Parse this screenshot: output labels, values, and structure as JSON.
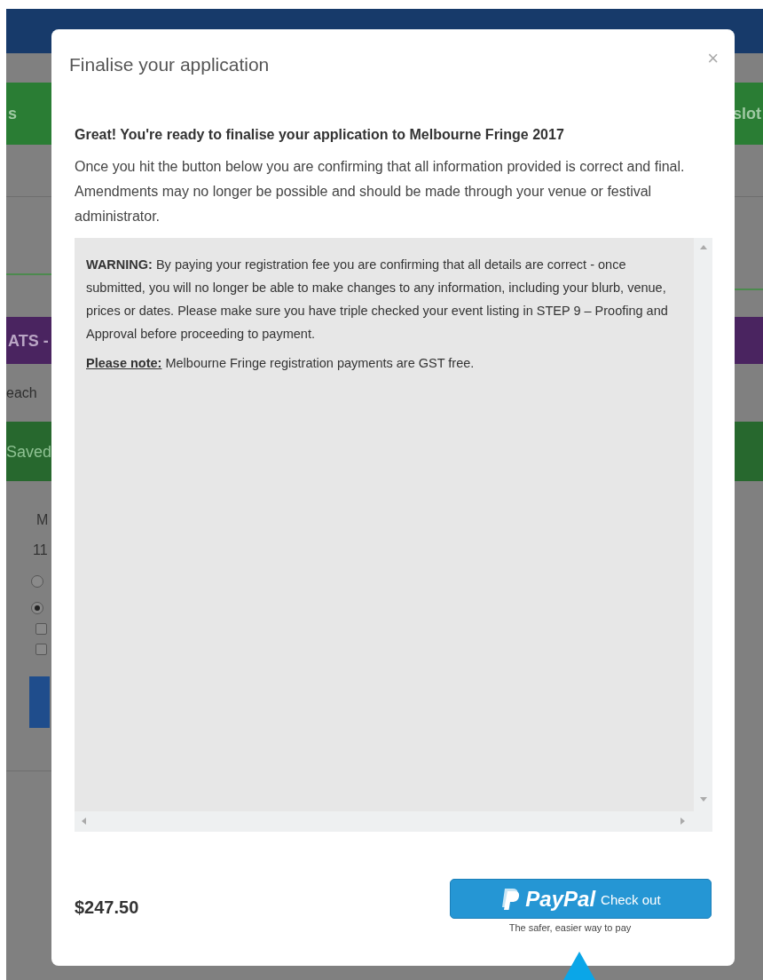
{
  "background": {
    "tab_bar": {
      "left_text": "s",
      "right_text": "slot"
    },
    "banner": "ATS -",
    "hint": "each",
    "status": "Saved",
    "column_header": "M",
    "column_value": "11",
    "radios": [
      {
        "selected": false
      },
      {
        "selected": true
      }
    ],
    "checkboxes": [
      {
        "checked": false
      },
      {
        "checked": false
      }
    ]
  },
  "modal": {
    "title": "Finalise your application",
    "close": "×",
    "heading": "Great! You're ready to finalise your application to Melbourne Fringe 2017",
    "intro": "Once you hit the button below you are confirming that all information provided is correct and final. Amendments may no longer be possible and should be made through your venue or festival administrator.",
    "warning": "**WARNING:** By paying your registration fee you are confirming that all details are correct - once submitted, you will no longer be able to make changes to any information, including your blurb, venue, prices or dates. Please make sure you have triple checked your event listing in STEP 9 – Proofing and Approval before proceeding to payment.",
    "note_label": "Please note:",
    "note_text": "Melbourne Fringe registration payments are GST free.",
    "price": "$247.50",
    "paypal": {
      "brand": "PayPal",
      "action": "Check out",
      "tagline": "The safer, easier way to pay"
    }
  }
}
